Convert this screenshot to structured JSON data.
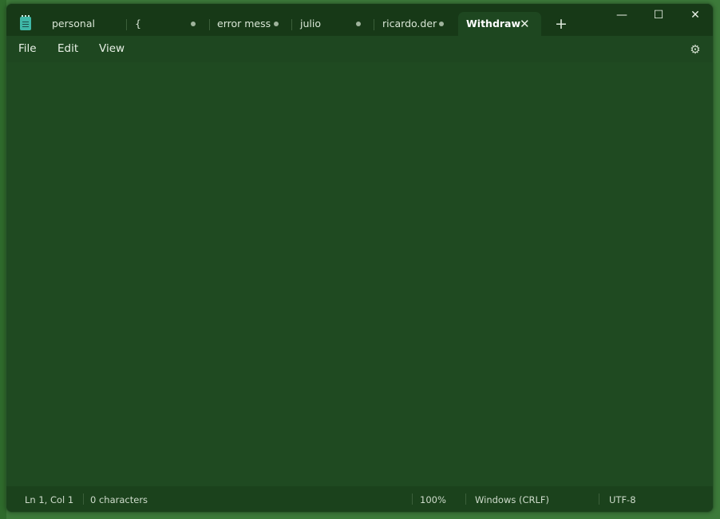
{
  "tabs": [
    {
      "label": "personal",
      "modified": false
    },
    {
      "label": "{",
      "modified": true
    },
    {
      "label": "error mess",
      "modified": true
    },
    {
      "label": "julio",
      "modified": true
    },
    {
      "label": "ricardo.der",
      "modified": true
    },
    {
      "label": "Withdraw",
      "modified": false,
      "active": true
    }
  ],
  "tab_close_glyph": "✕",
  "new_tab_glyph": "+",
  "window_controls": {
    "minimize": "—",
    "maximize": "☐",
    "close": "✕"
  },
  "menu": [
    "File",
    "Edit",
    "View"
  ],
  "settings_icon": "settings-icon",
  "editor": {
    "content": ""
  },
  "status": {
    "position": "Ln 1, Col 1",
    "characters": "0 characters",
    "zoom": "100%",
    "line_ending": "Windows (CRLF)",
    "encoding": "UTF-8"
  },
  "colors": {
    "titlebar": "#173917",
    "editor": "#1f4a21",
    "statusbar": "#1b421c",
    "app_icon": "#3fb8a8"
  }
}
